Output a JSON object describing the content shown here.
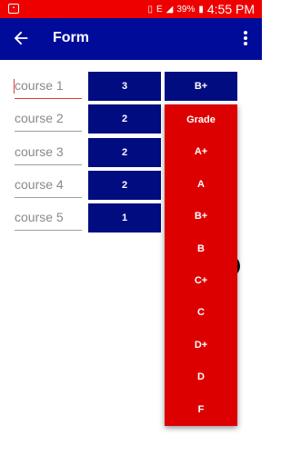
{
  "status_bar": {
    "battery_percent": "39%",
    "time": "4:55 PM",
    "network": "E"
  },
  "app_bar": {
    "title": "Form"
  },
  "courses": [
    {
      "name": "course 1",
      "credit": "3",
      "grade": "B+"
    },
    {
      "name": "course 2",
      "credit": "2"
    },
    {
      "name": "course 3",
      "credit": "2"
    },
    {
      "name": "course 4",
      "credit": "2"
    },
    {
      "name": "course 5",
      "credit": "1"
    }
  ],
  "grade_dropdown": {
    "options": [
      "Grade",
      "A+",
      "A",
      "B+",
      "B",
      "C+",
      "C",
      "D+",
      "D",
      "F"
    ]
  },
  "colors": {
    "status_bar": "#ee0000",
    "app_bar": "#000c99",
    "button": "#000c80",
    "dropdown": "#dd0000"
  }
}
